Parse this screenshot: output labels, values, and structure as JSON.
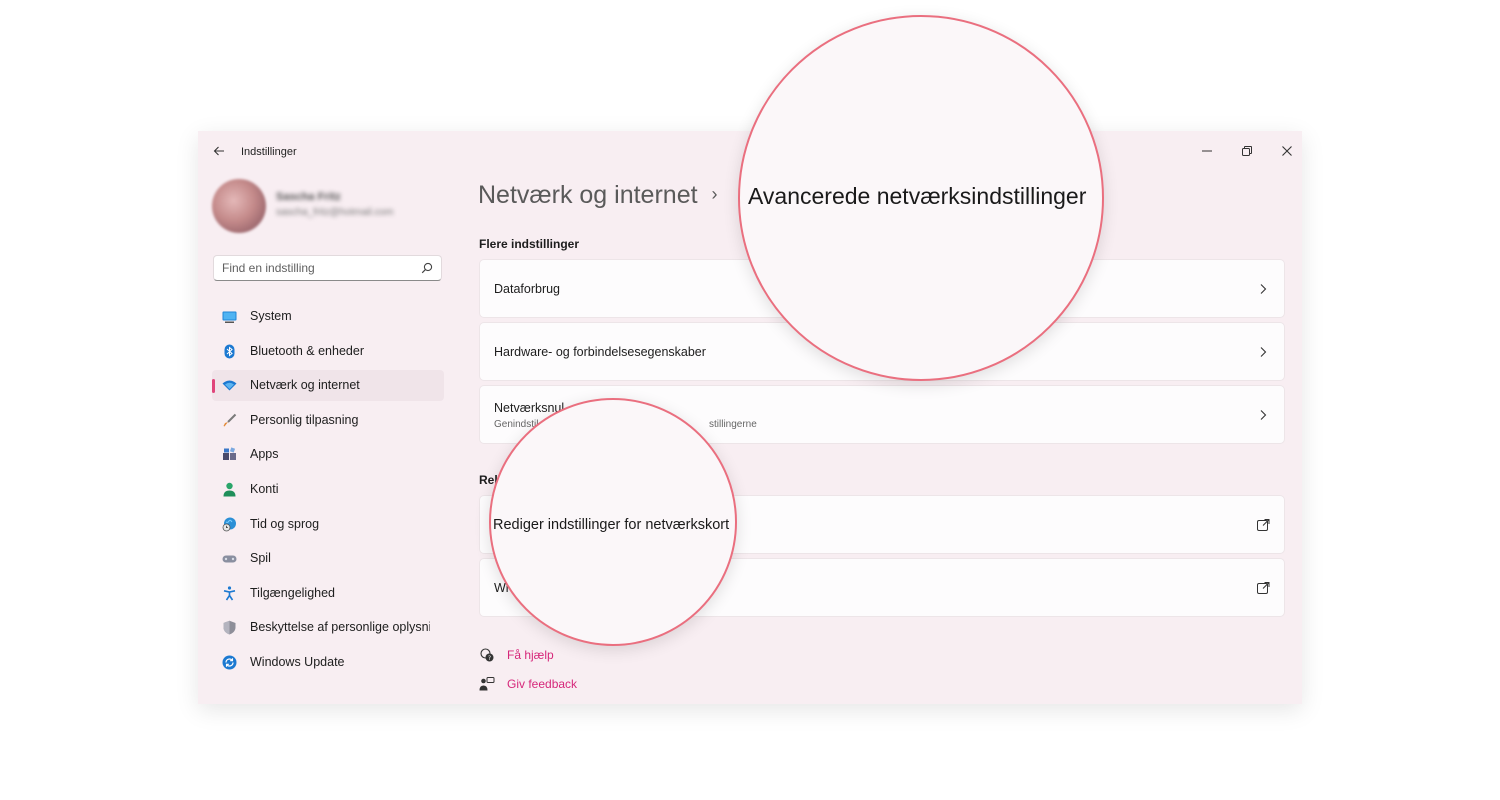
{
  "window": {
    "title": "Indstillinger"
  },
  "profile": {
    "name": "Sascha Fritz",
    "email": "sascha_fritz@hotmail.com"
  },
  "search": {
    "placeholder": "Find en indstilling"
  },
  "sidebar": {
    "items": [
      {
        "label": "System",
        "icon": "monitor-icon"
      },
      {
        "label": "Bluetooth & enheder",
        "icon": "bluetooth-icon"
      },
      {
        "label": "Netværk og internet",
        "icon": "wifi-icon",
        "active": true
      },
      {
        "label": "Personlig tilpasning",
        "icon": "brush-icon"
      },
      {
        "label": "Apps",
        "icon": "apps-icon"
      },
      {
        "label": "Konti",
        "icon": "person-icon"
      },
      {
        "label": "Tid og sprog",
        "icon": "globe-clock-icon"
      },
      {
        "label": "Spil",
        "icon": "gamepad-icon"
      },
      {
        "label": "Tilgængelighed",
        "icon": "accessibility-icon"
      },
      {
        "label": "Beskyttelse af personlige oplysninger",
        "icon": "shield-icon"
      },
      {
        "label": "Windows Update",
        "icon": "update-icon"
      }
    ]
  },
  "main": {
    "breadcrumb_parent": "Netværk og internet",
    "breadcrumb_current": "Avancerede netværksindstillinger",
    "more_settings_label": "Flere indstillinger",
    "cards_more": [
      {
        "title": "Dataforbrug"
      },
      {
        "title": "Hardware- og forbindelsesegenskaber"
      },
      {
        "title": "Netværksnul",
        "subtitle": "Genindstil",
        "subtitle_tail": "stillingerne"
      }
    ],
    "related_label": "Rel",
    "cards_related": [
      {
        "title": "Rediger indstillinger for netværkskort"
      },
      {
        "title": "Wi"
      }
    ],
    "help_label": "Få hjælp",
    "feedback_label": "Giv feedback"
  },
  "colors": {
    "accent": "#e0457b",
    "link": "#d6277a",
    "bubble_border": "#ea6f7f",
    "window_bg": "#f8eef2"
  }
}
